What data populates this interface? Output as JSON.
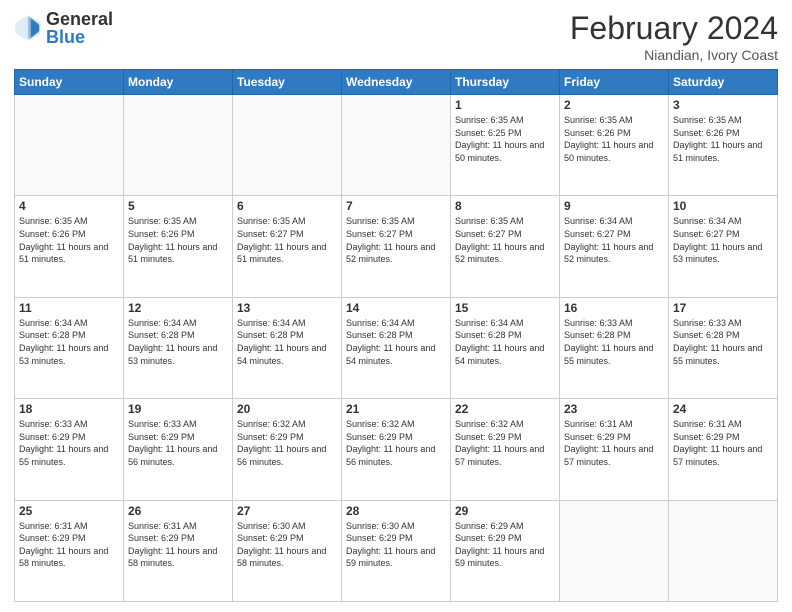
{
  "header": {
    "logo_general": "General",
    "logo_blue": "Blue",
    "title": "February 2024",
    "subtitle": "Niandian, Ivory Coast"
  },
  "days_of_week": [
    "Sunday",
    "Monday",
    "Tuesday",
    "Wednesday",
    "Thursday",
    "Friday",
    "Saturday"
  ],
  "weeks": [
    [
      {
        "num": "",
        "info": ""
      },
      {
        "num": "",
        "info": ""
      },
      {
        "num": "",
        "info": ""
      },
      {
        "num": "",
        "info": ""
      },
      {
        "num": "1",
        "info": "Sunrise: 6:35 AM\nSunset: 6:25 PM\nDaylight: 11 hours\nand 50 minutes."
      },
      {
        "num": "2",
        "info": "Sunrise: 6:35 AM\nSunset: 6:26 PM\nDaylight: 11 hours\nand 50 minutes."
      },
      {
        "num": "3",
        "info": "Sunrise: 6:35 AM\nSunset: 6:26 PM\nDaylight: 11 hours\nand 51 minutes."
      }
    ],
    [
      {
        "num": "4",
        "info": "Sunrise: 6:35 AM\nSunset: 6:26 PM\nDaylight: 11 hours\nand 51 minutes."
      },
      {
        "num": "5",
        "info": "Sunrise: 6:35 AM\nSunset: 6:26 PM\nDaylight: 11 hours\nand 51 minutes."
      },
      {
        "num": "6",
        "info": "Sunrise: 6:35 AM\nSunset: 6:27 PM\nDaylight: 11 hours\nand 51 minutes."
      },
      {
        "num": "7",
        "info": "Sunrise: 6:35 AM\nSunset: 6:27 PM\nDaylight: 11 hours\nand 52 minutes."
      },
      {
        "num": "8",
        "info": "Sunrise: 6:35 AM\nSunset: 6:27 PM\nDaylight: 11 hours\nand 52 minutes."
      },
      {
        "num": "9",
        "info": "Sunrise: 6:34 AM\nSunset: 6:27 PM\nDaylight: 11 hours\nand 52 minutes."
      },
      {
        "num": "10",
        "info": "Sunrise: 6:34 AM\nSunset: 6:27 PM\nDaylight: 11 hours\nand 53 minutes."
      }
    ],
    [
      {
        "num": "11",
        "info": "Sunrise: 6:34 AM\nSunset: 6:28 PM\nDaylight: 11 hours\nand 53 minutes."
      },
      {
        "num": "12",
        "info": "Sunrise: 6:34 AM\nSunset: 6:28 PM\nDaylight: 11 hours\nand 53 minutes."
      },
      {
        "num": "13",
        "info": "Sunrise: 6:34 AM\nSunset: 6:28 PM\nDaylight: 11 hours\nand 54 minutes."
      },
      {
        "num": "14",
        "info": "Sunrise: 6:34 AM\nSunset: 6:28 PM\nDaylight: 11 hours\nand 54 minutes."
      },
      {
        "num": "15",
        "info": "Sunrise: 6:34 AM\nSunset: 6:28 PM\nDaylight: 11 hours\nand 54 minutes."
      },
      {
        "num": "16",
        "info": "Sunrise: 6:33 AM\nSunset: 6:28 PM\nDaylight: 11 hours\nand 55 minutes."
      },
      {
        "num": "17",
        "info": "Sunrise: 6:33 AM\nSunset: 6:28 PM\nDaylight: 11 hours\nand 55 minutes."
      }
    ],
    [
      {
        "num": "18",
        "info": "Sunrise: 6:33 AM\nSunset: 6:29 PM\nDaylight: 11 hours\nand 55 minutes."
      },
      {
        "num": "19",
        "info": "Sunrise: 6:33 AM\nSunset: 6:29 PM\nDaylight: 11 hours\nand 56 minutes."
      },
      {
        "num": "20",
        "info": "Sunrise: 6:32 AM\nSunset: 6:29 PM\nDaylight: 11 hours\nand 56 minutes."
      },
      {
        "num": "21",
        "info": "Sunrise: 6:32 AM\nSunset: 6:29 PM\nDaylight: 11 hours\nand 56 minutes."
      },
      {
        "num": "22",
        "info": "Sunrise: 6:32 AM\nSunset: 6:29 PM\nDaylight: 11 hours\nand 57 minutes."
      },
      {
        "num": "23",
        "info": "Sunrise: 6:31 AM\nSunset: 6:29 PM\nDaylight: 11 hours\nand 57 minutes."
      },
      {
        "num": "24",
        "info": "Sunrise: 6:31 AM\nSunset: 6:29 PM\nDaylight: 11 hours\nand 57 minutes."
      }
    ],
    [
      {
        "num": "25",
        "info": "Sunrise: 6:31 AM\nSunset: 6:29 PM\nDaylight: 11 hours\nand 58 minutes."
      },
      {
        "num": "26",
        "info": "Sunrise: 6:31 AM\nSunset: 6:29 PM\nDaylight: 11 hours\nand 58 minutes."
      },
      {
        "num": "27",
        "info": "Sunrise: 6:30 AM\nSunset: 6:29 PM\nDaylight: 11 hours\nand 58 minutes."
      },
      {
        "num": "28",
        "info": "Sunrise: 6:30 AM\nSunset: 6:29 PM\nDaylight: 11 hours\nand 59 minutes."
      },
      {
        "num": "29",
        "info": "Sunrise: 6:29 AM\nSunset: 6:29 PM\nDaylight: 11 hours\nand 59 minutes."
      },
      {
        "num": "",
        "info": ""
      },
      {
        "num": "",
        "info": ""
      }
    ]
  ]
}
